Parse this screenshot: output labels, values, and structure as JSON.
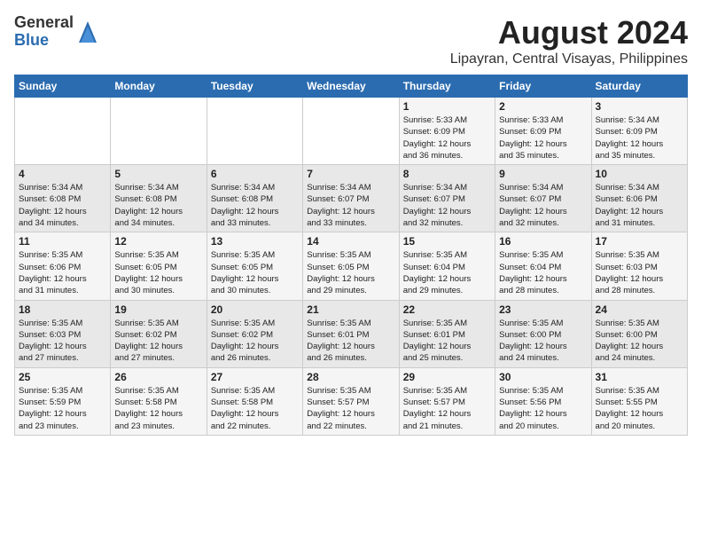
{
  "logo": {
    "general": "General",
    "blue": "Blue"
  },
  "title": {
    "month": "August 2024",
    "location": "Lipayran, Central Visayas, Philippines"
  },
  "weekdays": [
    "Sunday",
    "Monday",
    "Tuesday",
    "Wednesday",
    "Thursday",
    "Friday",
    "Saturday"
  ],
  "weeks": [
    [
      {
        "day": "",
        "info": ""
      },
      {
        "day": "",
        "info": ""
      },
      {
        "day": "",
        "info": ""
      },
      {
        "day": "",
        "info": ""
      },
      {
        "day": "1",
        "info": "Sunrise: 5:33 AM\nSunset: 6:09 PM\nDaylight: 12 hours\nand 36 minutes."
      },
      {
        "day": "2",
        "info": "Sunrise: 5:33 AM\nSunset: 6:09 PM\nDaylight: 12 hours\nand 35 minutes."
      },
      {
        "day": "3",
        "info": "Sunrise: 5:34 AM\nSunset: 6:09 PM\nDaylight: 12 hours\nand 35 minutes."
      }
    ],
    [
      {
        "day": "4",
        "info": "Sunrise: 5:34 AM\nSunset: 6:08 PM\nDaylight: 12 hours\nand 34 minutes."
      },
      {
        "day": "5",
        "info": "Sunrise: 5:34 AM\nSunset: 6:08 PM\nDaylight: 12 hours\nand 34 minutes."
      },
      {
        "day": "6",
        "info": "Sunrise: 5:34 AM\nSunset: 6:08 PM\nDaylight: 12 hours\nand 33 minutes."
      },
      {
        "day": "7",
        "info": "Sunrise: 5:34 AM\nSunset: 6:07 PM\nDaylight: 12 hours\nand 33 minutes."
      },
      {
        "day": "8",
        "info": "Sunrise: 5:34 AM\nSunset: 6:07 PM\nDaylight: 12 hours\nand 32 minutes."
      },
      {
        "day": "9",
        "info": "Sunrise: 5:34 AM\nSunset: 6:07 PM\nDaylight: 12 hours\nand 32 minutes."
      },
      {
        "day": "10",
        "info": "Sunrise: 5:34 AM\nSunset: 6:06 PM\nDaylight: 12 hours\nand 31 minutes."
      }
    ],
    [
      {
        "day": "11",
        "info": "Sunrise: 5:35 AM\nSunset: 6:06 PM\nDaylight: 12 hours\nand 31 minutes."
      },
      {
        "day": "12",
        "info": "Sunrise: 5:35 AM\nSunset: 6:05 PM\nDaylight: 12 hours\nand 30 minutes."
      },
      {
        "day": "13",
        "info": "Sunrise: 5:35 AM\nSunset: 6:05 PM\nDaylight: 12 hours\nand 30 minutes."
      },
      {
        "day": "14",
        "info": "Sunrise: 5:35 AM\nSunset: 6:05 PM\nDaylight: 12 hours\nand 29 minutes."
      },
      {
        "day": "15",
        "info": "Sunrise: 5:35 AM\nSunset: 6:04 PM\nDaylight: 12 hours\nand 29 minutes."
      },
      {
        "day": "16",
        "info": "Sunrise: 5:35 AM\nSunset: 6:04 PM\nDaylight: 12 hours\nand 28 minutes."
      },
      {
        "day": "17",
        "info": "Sunrise: 5:35 AM\nSunset: 6:03 PM\nDaylight: 12 hours\nand 28 minutes."
      }
    ],
    [
      {
        "day": "18",
        "info": "Sunrise: 5:35 AM\nSunset: 6:03 PM\nDaylight: 12 hours\nand 27 minutes."
      },
      {
        "day": "19",
        "info": "Sunrise: 5:35 AM\nSunset: 6:02 PM\nDaylight: 12 hours\nand 27 minutes."
      },
      {
        "day": "20",
        "info": "Sunrise: 5:35 AM\nSunset: 6:02 PM\nDaylight: 12 hours\nand 26 minutes."
      },
      {
        "day": "21",
        "info": "Sunrise: 5:35 AM\nSunset: 6:01 PM\nDaylight: 12 hours\nand 26 minutes."
      },
      {
        "day": "22",
        "info": "Sunrise: 5:35 AM\nSunset: 6:01 PM\nDaylight: 12 hours\nand 25 minutes."
      },
      {
        "day": "23",
        "info": "Sunrise: 5:35 AM\nSunset: 6:00 PM\nDaylight: 12 hours\nand 24 minutes."
      },
      {
        "day": "24",
        "info": "Sunrise: 5:35 AM\nSunset: 6:00 PM\nDaylight: 12 hours\nand 24 minutes."
      }
    ],
    [
      {
        "day": "25",
        "info": "Sunrise: 5:35 AM\nSunset: 5:59 PM\nDaylight: 12 hours\nand 23 minutes."
      },
      {
        "day": "26",
        "info": "Sunrise: 5:35 AM\nSunset: 5:58 PM\nDaylight: 12 hours\nand 23 minutes."
      },
      {
        "day": "27",
        "info": "Sunrise: 5:35 AM\nSunset: 5:58 PM\nDaylight: 12 hours\nand 22 minutes."
      },
      {
        "day": "28",
        "info": "Sunrise: 5:35 AM\nSunset: 5:57 PM\nDaylight: 12 hours\nand 22 minutes."
      },
      {
        "day": "29",
        "info": "Sunrise: 5:35 AM\nSunset: 5:57 PM\nDaylight: 12 hours\nand 21 minutes."
      },
      {
        "day": "30",
        "info": "Sunrise: 5:35 AM\nSunset: 5:56 PM\nDaylight: 12 hours\nand 20 minutes."
      },
      {
        "day": "31",
        "info": "Sunrise: 5:35 AM\nSunset: 5:55 PM\nDaylight: 12 hours\nand 20 minutes."
      }
    ]
  ]
}
